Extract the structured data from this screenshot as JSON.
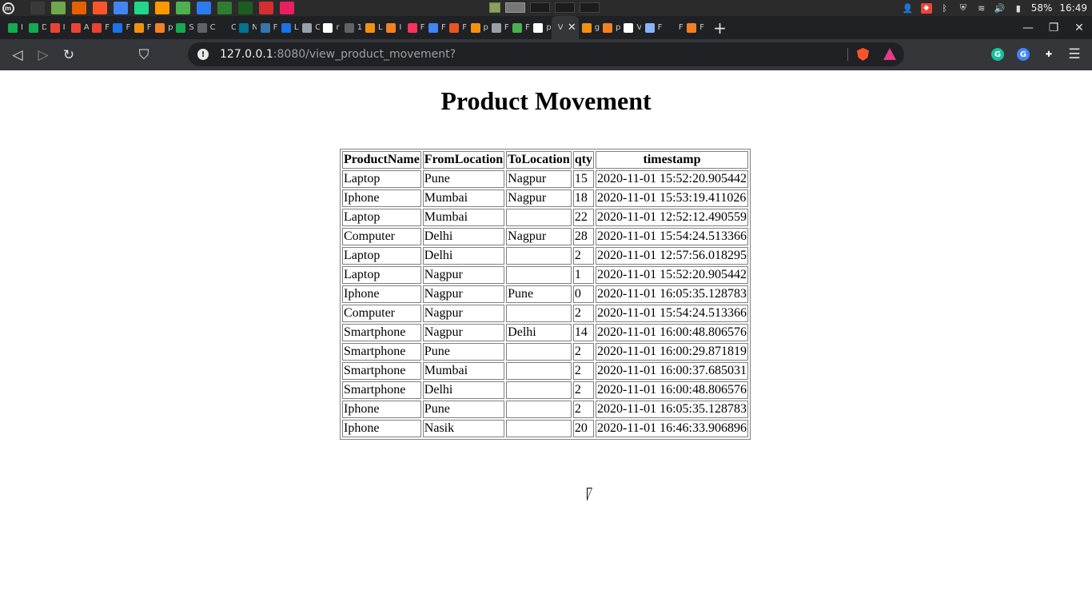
{
  "system": {
    "battery": "58%",
    "clock": "16:49",
    "workspace_count": 5,
    "active_workspace": 2,
    "launcher_icons": [
      "terminal-icon",
      "files-icon",
      "firefox-icon",
      "brave-icon",
      "chrome-icon",
      "pycharm-icon",
      "sublime-icon",
      "mongodb-compass-icon",
      "intellij-icon",
      "spreadsheet-icon",
      "system-monitor-icon",
      "screenshot-icon",
      "image-viewer-icon"
    ],
    "launcher_colors": [
      "#3a3a3a",
      "#6fa84a",
      "#e66000",
      "#fb542b",
      "#4285f4",
      "#21d789",
      "#ff9800",
      "#4caf50",
      "#2b7cf0",
      "#2e7d32",
      "#1b5e20",
      "#d32f2f",
      "#e91e63"
    ]
  },
  "browser": {
    "tabs": [
      {
        "title": "I",
        "icon": "mongodb-icon",
        "color": "#13aa52"
      },
      {
        "title": "D",
        "icon": "mongodb-icon",
        "color": "#13aa52"
      },
      {
        "title": "I",
        "icon": "gmail-icon",
        "color": "#ea4335"
      },
      {
        "title": "A",
        "icon": "gmail-icon",
        "color": "#ea4335"
      },
      {
        "title": "F",
        "icon": "gmail-icon",
        "color": "#ea4335"
      },
      {
        "title": "F",
        "icon": "flask-icon",
        "color": "#1a73e8"
      },
      {
        "title": "F",
        "icon": "django-icon",
        "color": "#f29111"
      },
      {
        "title": "p",
        "icon": "stackoverflow-icon",
        "color": "#f48024"
      },
      {
        "title": "S",
        "icon": "mongodb-icon",
        "color": "#13aa52"
      },
      {
        "title": "C",
        "icon": "moon-icon",
        "color": "#5f6368"
      },
      {
        "title": "C",
        "icon": "moon-icon",
        "color": "#202124"
      },
      {
        "title": "N",
        "icon": "mysql-icon",
        "color": "#00758f"
      },
      {
        "title": "F",
        "icon": "python-icon",
        "color": "#3776ab"
      },
      {
        "title": "L",
        "icon": "docs-icon",
        "color": "#1a73e8"
      },
      {
        "title": "C",
        "icon": "book-icon",
        "color": "#9aa0a6"
      },
      {
        "title": "r",
        "icon": "github-icon",
        "color": "#ffffff"
      },
      {
        "title": "1",
        "icon": "globe-icon",
        "color": "#5f6368"
      },
      {
        "title": "L",
        "icon": "django-icon",
        "color": "#f29111"
      },
      {
        "title": "I",
        "icon": "stackoverflow-icon",
        "color": "#f48024"
      },
      {
        "title": "F",
        "icon": "jetbrains-icon",
        "color": "#fe315d"
      },
      {
        "title": "F",
        "icon": "gcloud-icon",
        "color": "#4285f4"
      },
      {
        "title": "F",
        "icon": "ubuntu-icon",
        "color": "#e95420"
      },
      {
        "title": "p",
        "icon": "django-icon",
        "color": "#f29111"
      },
      {
        "title": "F",
        "icon": "book-icon",
        "color": "#9aa0a6"
      },
      {
        "title": "F",
        "icon": "w3schools-icon",
        "color": "#4caf50"
      },
      {
        "title": "p",
        "icon": "github-icon",
        "color": "#ffffff"
      },
      {
        "title": "V",
        "icon": "",
        "color": "#35363a",
        "active": true
      },
      {
        "title": "g",
        "icon": "django-icon",
        "color": "#f29111"
      },
      {
        "title": "p",
        "icon": "stackoverflow-icon",
        "color": "#f48024"
      },
      {
        "title": "V",
        "icon": "hexagon-icon",
        "color": "#ffffff"
      },
      {
        "title": "F",
        "icon": "gear-icon",
        "color": "#8ab4f8"
      },
      {
        "title": "F",
        "icon": "book-icon",
        "color": "#202124"
      },
      {
        "title": "F",
        "icon": "stackoverflow-icon",
        "color": "#f48024"
      }
    ],
    "url_host": "127.0.0.1",
    "url_rest": ":8080/view_product_movement?",
    "extensions": [
      {
        "name": "grammarly-icon",
        "color": "#15c39a",
        "glyph": "G"
      },
      {
        "name": "translate-icon",
        "color": "#4285f4",
        "glyph": "G"
      },
      {
        "name": "extensions-icon",
        "color": "#35363a",
        "glyph": "✚"
      }
    ]
  },
  "page": {
    "title": "Product Movement",
    "columns": [
      "ProductName",
      "FromLocation",
      "ToLocation",
      "qty",
      "timestamp"
    ],
    "rows": [
      [
        "Laptop",
        "Pune",
        "Nagpur",
        "15",
        "2020-11-01 15:52:20.905442"
      ],
      [
        "Iphone",
        "Mumbai",
        "Nagpur",
        "18",
        "2020-11-01 15:53:19.411026"
      ],
      [
        "Laptop",
        "Mumbai",
        "",
        "22",
        "2020-11-01 12:52:12.490559"
      ],
      [
        "Computer",
        "Delhi",
        "Nagpur",
        "28",
        "2020-11-01 15:54:24.513366"
      ],
      [
        "Laptop",
        "Delhi",
        "",
        "2",
        "2020-11-01 12:57:56.018295"
      ],
      [
        "Laptop",
        "Nagpur",
        "",
        "1",
        "2020-11-01 15:52:20.905442"
      ],
      [
        "Iphone",
        "Nagpur",
        "Pune",
        "0",
        "2020-11-01 16:05:35.128783"
      ],
      [
        "Computer",
        "Nagpur",
        "",
        "2",
        "2020-11-01 15:54:24.513366"
      ],
      [
        "Smartphone",
        "Nagpur",
        "Delhi",
        "14",
        "2020-11-01 16:00:48.806576"
      ],
      [
        "Smartphone",
        "Pune",
        "",
        "2",
        "2020-11-01 16:00:29.871819"
      ],
      [
        "Smartphone",
        "Mumbai",
        "",
        "2",
        "2020-11-01 16:00:37.685031"
      ],
      [
        "Smartphone",
        "Delhi",
        "",
        "2",
        "2020-11-01 16:00:48.806576"
      ],
      [
        "Iphone",
        "Pune",
        "",
        "2",
        "2020-11-01 16:05:35.128783"
      ],
      [
        "Iphone",
        "Nasik",
        "",
        "20",
        "2020-11-01 16:46:33.906896"
      ]
    ]
  }
}
